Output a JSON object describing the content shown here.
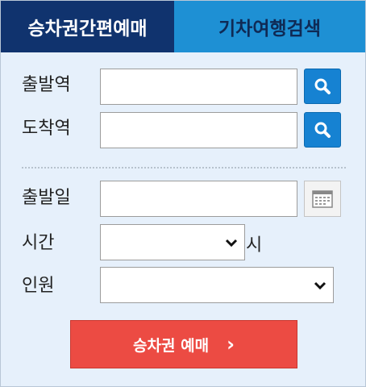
{
  "tabs": [
    {
      "label": "승차권간편예매",
      "active": true
    },
    {
      "label": "기차여행검색",
      "active": false
    }
  ],
  "form": {
    "departure": {
      "label": "출발역",
      "value": ""
    },
    "arrival": {
      "label": "도착역",
      "value": ""
    },
    "date": {
      "label": "출발일",
      "value": ""
    },
    "time": {
      "label": "시간",
      "value": "",
      "suffix": "시"
    },
    "passengers": {
      "label": "인원",
      "value": ""
    }
  },
  "submit": {
    "label": "승차권 예매",
    "arrow": "›"
  },
  "colors": {
    "tab_active": "#10336e",
    "tab_inactive": "#1e90d4",
    "search_button": "#1682d2",
    "submit_button": "#ec4b43",
    "panel_background": "#e6f0fb"
  },
  "icons": {
    "search": "magnifier-icon",
    "calendar": "calendar-icon",
    "dropdown": "chevron-down-icon"
  }
}
